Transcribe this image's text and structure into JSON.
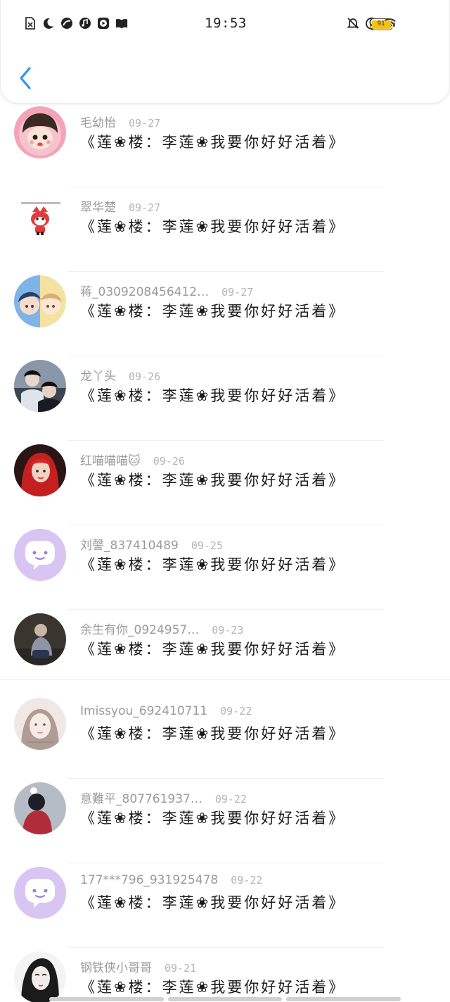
{
  "status_bar": {
    "time": "19:53",
    "battery_level": "91",
    "left_icons": [
      "sim-off-icon",
      "moon-icon",
      "app-icon",
      "music-icon",
      "video-icon",
      "book-icon"
    ],
    "right_icons": [
      "bell-off-icon",
      "moon-icon",
      "wifi-icon"
    ],
    "battery_color": "#f3c21a"
  },
  "header": {
    "back_icon": "chevron-left-icon",
    "accent_color": "#2f95f0"
  },
  "comments": [
    {
      "name": "毛幼怡",
      "date": "09-27",
      "text": "《莲❀楼：李莲❀我要你好好活着》",
      "avatar": "cartoon-girl-pink"
    },
    {
      "name": "翠华楚",
      "date": "09-27",
      "text": "《莲❀楼：李莲❀我要你好好活着》",
      "avatar": "cartoon-fox"
    },
    {
      "name": "蒋_0309208456412…",
      "date": "09-27",
      "text": "《莲❀楼：李莲❀我要你好好活着》",
      "avatar": "anime-boys"
    },
    {
      "name": "龙丫头",
      "date": "09-26",
      "text": "《莲❀楼：李莲❀我要你好好活着》",
      "avatar": "drama-actors"
    },
    {
      "name": "红喵喵喵🐱",
      "date": "09-26",
      "text": "《莲❀楼：李莲❀我要你好好活着》",
      "avatar": "red-hair-girl"
    },
    {
      "name": "刘謦_837410489",
      "date": "09-25",
      "text": "《莲❀楼：李莲❀我要你好好活着》",
      "avatar": "default-chat"
    },
    {
      "name": "余生有你_0924957…",
      "date": "09-23",
      "text": "《莲❀楼：李莲❀我要你好好活着》",
      "avatar": "sitting-person"
    },
    {
      "name": "Imissyou_692410711",
      "date": "09-22",
      "text": "《莲❀楼：李莲❀我要你好好活着》",
      "avatar": "girl-face-pale"
    },
    {
      "name": "意難平_807761937…",
      "date": "09-22",
      "text": "《莲❀楼：李莲❀我要你好好活着》",
      "avatar": "girl-back"
    },
    {
      "name": "177***796_931925478",
      "date": "09-22",
      "text": "《莲❀楼：李莲❀我要你好好活着》",
      "avatar": "default-chat"
    },
    {
      "name": "钢铁侠小哥哥",
      "date": "09-21",
      "text": "《莲❀楼：李莲❀我要你好好活着》",
      "avatar": "sketch-girl"
    }
  ]
}
